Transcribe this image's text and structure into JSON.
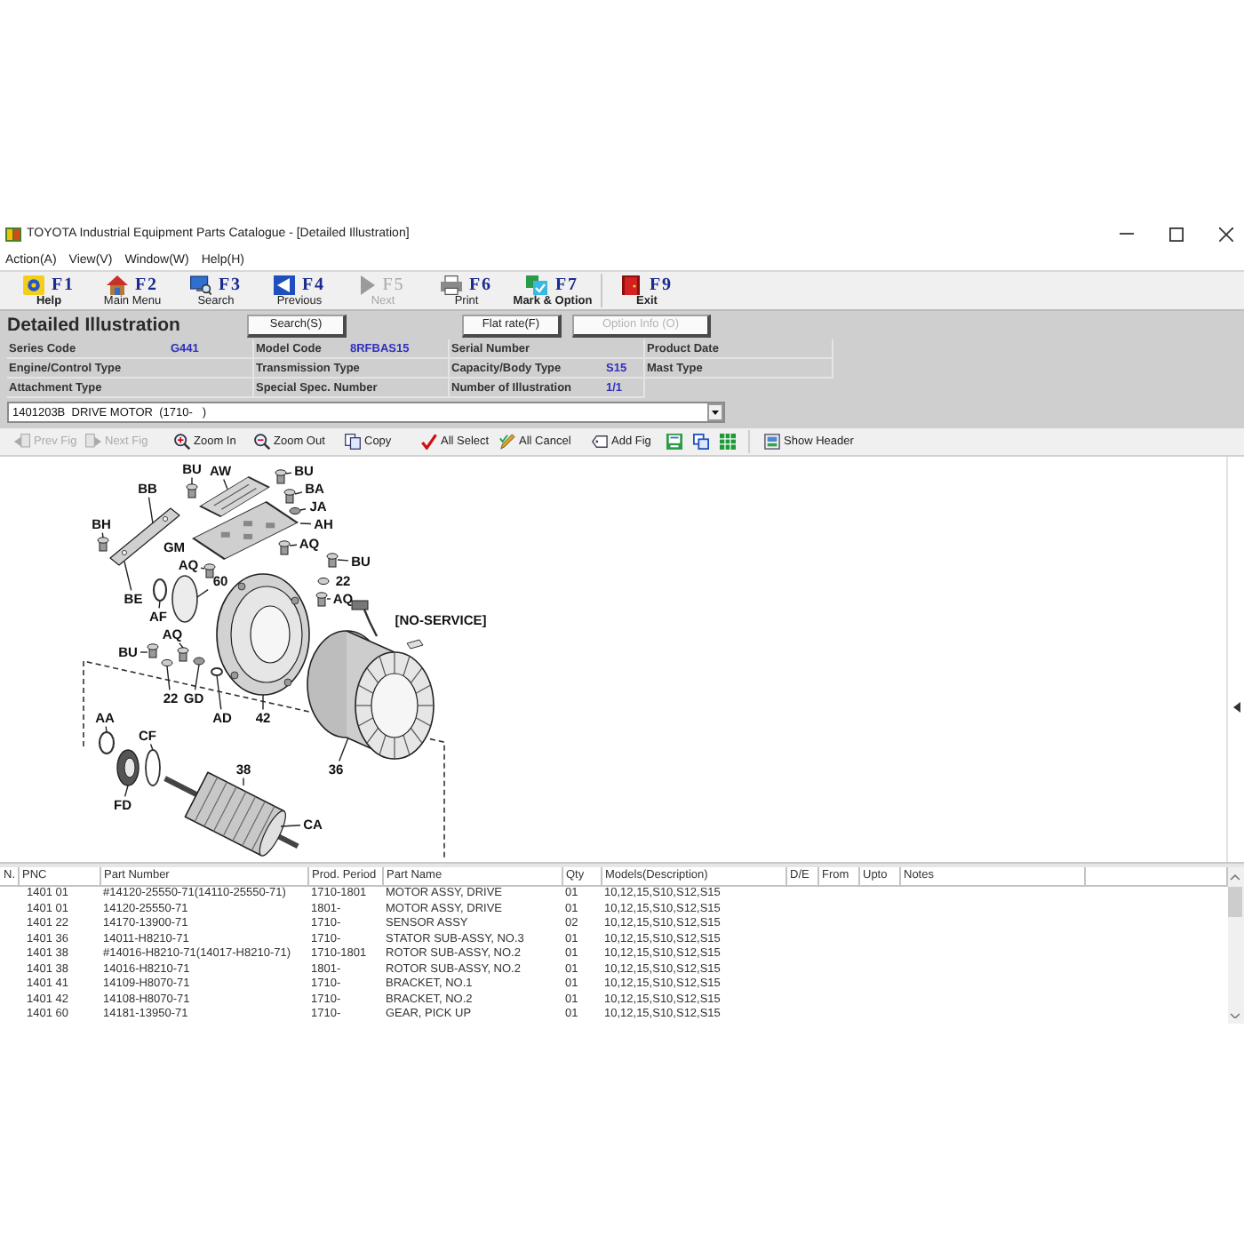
{
  "window": {
    "title": "TOYOTA Industrial Equipment Parts Catalogue - [Detailed Illustration]"
  },
  "menu": [
    "Action(A)",
    "View(V)",
    "Window(W)",
    "Help(H)"
  ],
  "function_keys": [
    {
      "key": "F1",
      "label": "Help",
      "bold": true,
      "disabled": false
    },
    {
      "key": "F2",
      "label": "Main Menu",
      "bold": false,
      "disabled": false
    },
    {
      "key": "F3",
      "label": "Search",
      "bold": false,
      "disabled": false
    },
    {
      "key": "F4",
      "label": "Previous",
      "bold": false,
      "disabled": false
    },
    {
      "key": "F5",
      "label": "Next",
      "bold": false,
      "disabled": true
    },
    {
      "key": "F6",
      "label": "Print",
      "bold": false,
      "disabled": false
    },
    {
      "key": "F7",
      "label": "Mark & Option",
      "bold": true,
      "disabled": false
    },
    {
      "key": "F9",
      "label": "Exit",
      "bold": true,
      "disabled": false
    }
  ],
  "header": {
    "title": "Detailed Illustration",
    "buttons": [
      {
        "label": "Search(S)",
        "disabled": false
      },
      {
        "label": "Flat rate(F)",
        "disabled": false
      },
      {
        "label": "Option Info (O)",
        "disabled": true
      }
    ]
  },
  "info_rows": [
    [
      {
        "label": "Series Code",
        "value": "G441"
      },
      {
        "label": "Model Code",
        "value": "8RFBAS15"
      },
      {
        "label": "Serial Number"
      },
      {
        "label": "Product Date"
      }
    ],
    [
      {
        "label": "Engine/Control Type"
      },
      {
        "label": "Transmission Type"
      },
      {
        "label": "Capacity/Body Type",
        "value": "S15"
      },
      {
        "label": "Mast Type"
      }
    ],
    [
      {
        "label": "Attachment Type"
      },
      {
        "label": "Special Spec. Number"
      },
      {
        "label": "Number of Illustration",
        "value": "1/1"
      }
    ]
  ],
  "illustration_select": {
    "value": "1401203B  DRIVE MOTOR  (1710-   )"
  },
  "figure_toolbar": {
    "buttons": [
      {
        "label": "Prev Fig",
        "disabled": true
      },
      {
        "label": "Next Fig",
        "disabled": true
      },
      {
        "label": "Zoom In",
        "disabled": false
      },
      {
        "label": "Zoom Out",
        "disabled": false
      },
      {
        "label": "Copy",
        "disabled": false
      },
      {
        "label": "All Select",
        "disabled": false
      },
      {
        "label": "All Cancel",
        "disabled": false
      },
      {
        "label": "Add Fig",
        "disabled": false
      }
    ],
    "header_toggle": {
      "label": "Show Header"
    }
  },
  "diagram": {
    "callouts": [
      "BU",
      "AW",
      "BU",
      "BB",
      "BA",
      "JA",
      "BH",
      "AH",
      "GM",
      "AQ",
      "AQ",
      "BU",
      "60",
      "22",
      "BE",
      "AQ",
      "AF",
      "AQ",
      "BU",
      "22",
      "GD",
      "AA",
      "AD",
      "42",
      "CF",
      "38",
      "36",
      "FD",
      "CA"
    ],
    "note": "[NO-SERVICE]"
  },
  "table": {
    "columns": [
      "N.",
      "PNC",
      "Part Number",
      "Prod. Period",
      "Part Name",
      "Qty",
      "Models(Description)",
      "D/E",
      "From",
      "Upto",
      "Notes"
    ],
    "rows": [
      {
        "pnc": "1401 01",
        "part_number": "#14120-25550-71(14110-25550-71)",
        "period": "1710-1801",
        "name": "MOTOR ASSY, DRIVE",
        "qty": "01",
        "models": "10,12,15,S10,S12,S15"
      },
      {
        "pnc": "1401 01",
        "part_number": "14120-25550-71",
        "period": "1801-",
        "name": "MOTOR ASSY, DRIVE",
        "qty": "01",
        "models": "10,12,15,S10,S12,S15"
      },
      {
        "pnc": "1401 22",
        "part_number": "14170-13900-71",
        "period": "1710-",
        "name": "SENSOR ASSY",
        "qty": "02",
        "models": "10,12,15,S10,S12,S15"
      },
      {
        "pnc": "1401 36",
        "part_number": "14011-H8210-71",
        "period": "1710-",
        "name": "STATOR SUB-ASSY, NO.3",
        "qty": "01",
        "models": "10,12,15,S10,S12,S15"
      },
      {
        "pnc": "1401 38",
        "part_number": "#14016-H8210-71(14017-H8210-71)",
        "period": "1710-1801",
        "name": "ROTOR SUB-ASSY, NO.2",
        "qty": "01",
        "models": "10,12,15,S10,S12,S15"
      },
      {
        "pnc": "1401 38",
        "part_number": "14016-H8210-71",
        "period": "1801-",
        "name": "ROTOR SUB-ASSY, NO.2",
        "qty": "01",
        "models": "10,12,15,S10,S12,S15"
      },
      {
        "pnc": "1401 41",
        "part_number": "14109-H8070-71",
        "period": "1710-",
        "name": "BRACKET, NO.1",
        "qty": "01",
        "models": "10,12,15,S10,S12,S15"
      },
      {
        "pnc": "1401 42",
        "part_number": "14108-H8070-71",
        "period": "1710-",
        "name": "BRACKET, NO.2",
        "qty": "01",
        "models": "10,12,15,S10,S12,S15"
      },
      {
        "pnc": "1401 60",
        "part_number": "14181-13950-71",
        "period": "1710-",
        "name": "GEAR, PICK UP",
        "qty": "01",
        "models": "10,12,15,S10,S12,S15"
      }
    ]
  }
}
